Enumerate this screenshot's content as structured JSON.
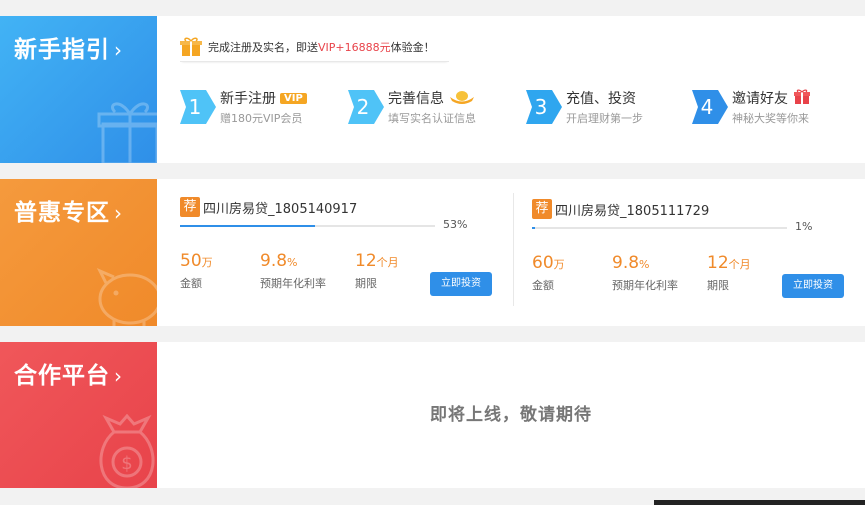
{
  "guide": {
    "title": "新手指引",
    "chevron": "›",
    "promo": {
      "prefix": "完成注册及实名，即送",
      "highlight": "VIP+16888元",
      "suffix": "体验金！"
    },
    "steps": [
      {
        "num": "1",
        "title": "新手注册",
        "badge": "VIP",
        "desc": "赠180元VIP会员",
        "icon": "none"
      },
      {
        "num": "2",
        "title": "完善信息",
        "desc": "填写实名认证信息",
        "icon": "gold-ingot-icon"
      },
      {
        "num": "3",
        "title": "充值、投资",
        "desc": "开启理财第一步",
        "icon": "none"
      },
      {
        "num": "4",
        "title": "邀请好友",
        "desc": "神秘大奖等你来",
        "icon": "gift-icon"
      }
    ]
  },
  "benefits": {
    "title": "普惠专区",
    "chevron": "›",
    "products": [
      {
        "tag": "荐",
        "name": "四川房易贷_1805140917",
        "progress_pct": 53,
        "progress_label": "53%",
        "amount": "50",
        "amount_unit": "万",
        "amount_label": "金额",
        "rate": "9.8",
        "rate_unit": "%",
        "rate_label": "预期年化利率",
        "term": "12",
        "term_unit": "个月",
        "term_label": "期限",
        "button": "立即投资"
      },
      {
        "tag": "荐",
        "name": "四川房易贷_1805111729",
        "progress_pct": 1,
        "progress_label": "1%",
        "amount": "60",
        "amount_unit": "万",
        "amount_label": "金额",
        "rate": "9.8",
        "rate_unit": "%",
        "rate_label": "预期年化利率",
        "term": "12",
        "term_unit": "个月",
        "term_label": "期限",
        "button": "立即投资"
      }
    ]
  },
  "partner": {
    "title": "合作平台",
    "chevron": "›",
    "coming_soon": "即将上线，敬请期待"
  },
  "colors": {
    "blue": "#2f8fe8",
    "orange": "#f08a2a",
    "red": "#e8434a"
  }
}
